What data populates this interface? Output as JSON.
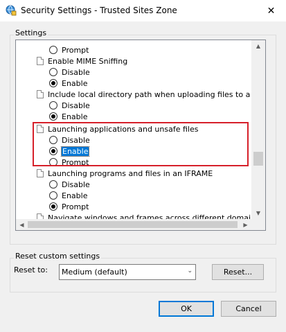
{
  "window": {
    "title": "Security Settings - Trusted Sites Zone",
    "close_glyph": "✕"
  },
  "settings": {
    "group_label": "Settings",
    "rows": [
      {
        "kind": "option",
        "label": "Prompt",
        "selected": false
      },
      {
        "kind": "setting",
        "label": "Enable MIME Sniffing"
      },
      {
        "kind": "option",
        "label": "Disable",
        "selected": false
      },
      {
        "kind": "option",
        "label": "Enable",
        "selected": true
      },
      {
        "kind": "setting",
        "label": "Include local directory path when uploading files to a server"
      },
      {
        "kind": "option",
        "label": "Disable",
        "selected": false
      },
      {
        "kind": "option",
        "label": "Enable",
        "selected": true
      },
      {
        "kind": "setting",
        "label": "Launching applications and unsafe files"
      },
      {
        "kind": "option",
        "label": "Disable",
        "selected": false
      },
      {
        "kind": "option",
        "label": "Enable",
        "selected": true,
        "focused": true
      },
      {
        "kind": "option",
        "label": "Prompt",
        "selected": false
      },
      {
        "kind": "setting",
        "label": "Launching programs and files in an IFRAME"
      },
      {
        "kind": "option",
        "label": "Disable",
        "selected": false
      },
      {
        "kind": "option",
        "label": "Enable",
        "selected": false
      },
      {
        "kind": "option",
        "label": "Prompt",
        "selected": true
      },
      {
        "kind": "setting",
        "label": "Navigate windows and frames across different domains"
      }
    ]
  },
  "scrollbar": {
    "up": "▲",
    "down": "▼",
    "left": "◀",
    "right": "▶"
  },
  "reset": {
    "group_label": "Reset custom settings",
    "reset_to_label": "Reset to:",
    "selected_level": "Medium (default)",
    "arrow": "⌄",
    "reset_button": "Reset..."
  },
  "footer": {
    "ok": "OK",
    "cancel": "Cancel"
  },
  "colors": {
    "highlight_box": "#d6202a",
    "selection": "#0078d7"
  }
}
